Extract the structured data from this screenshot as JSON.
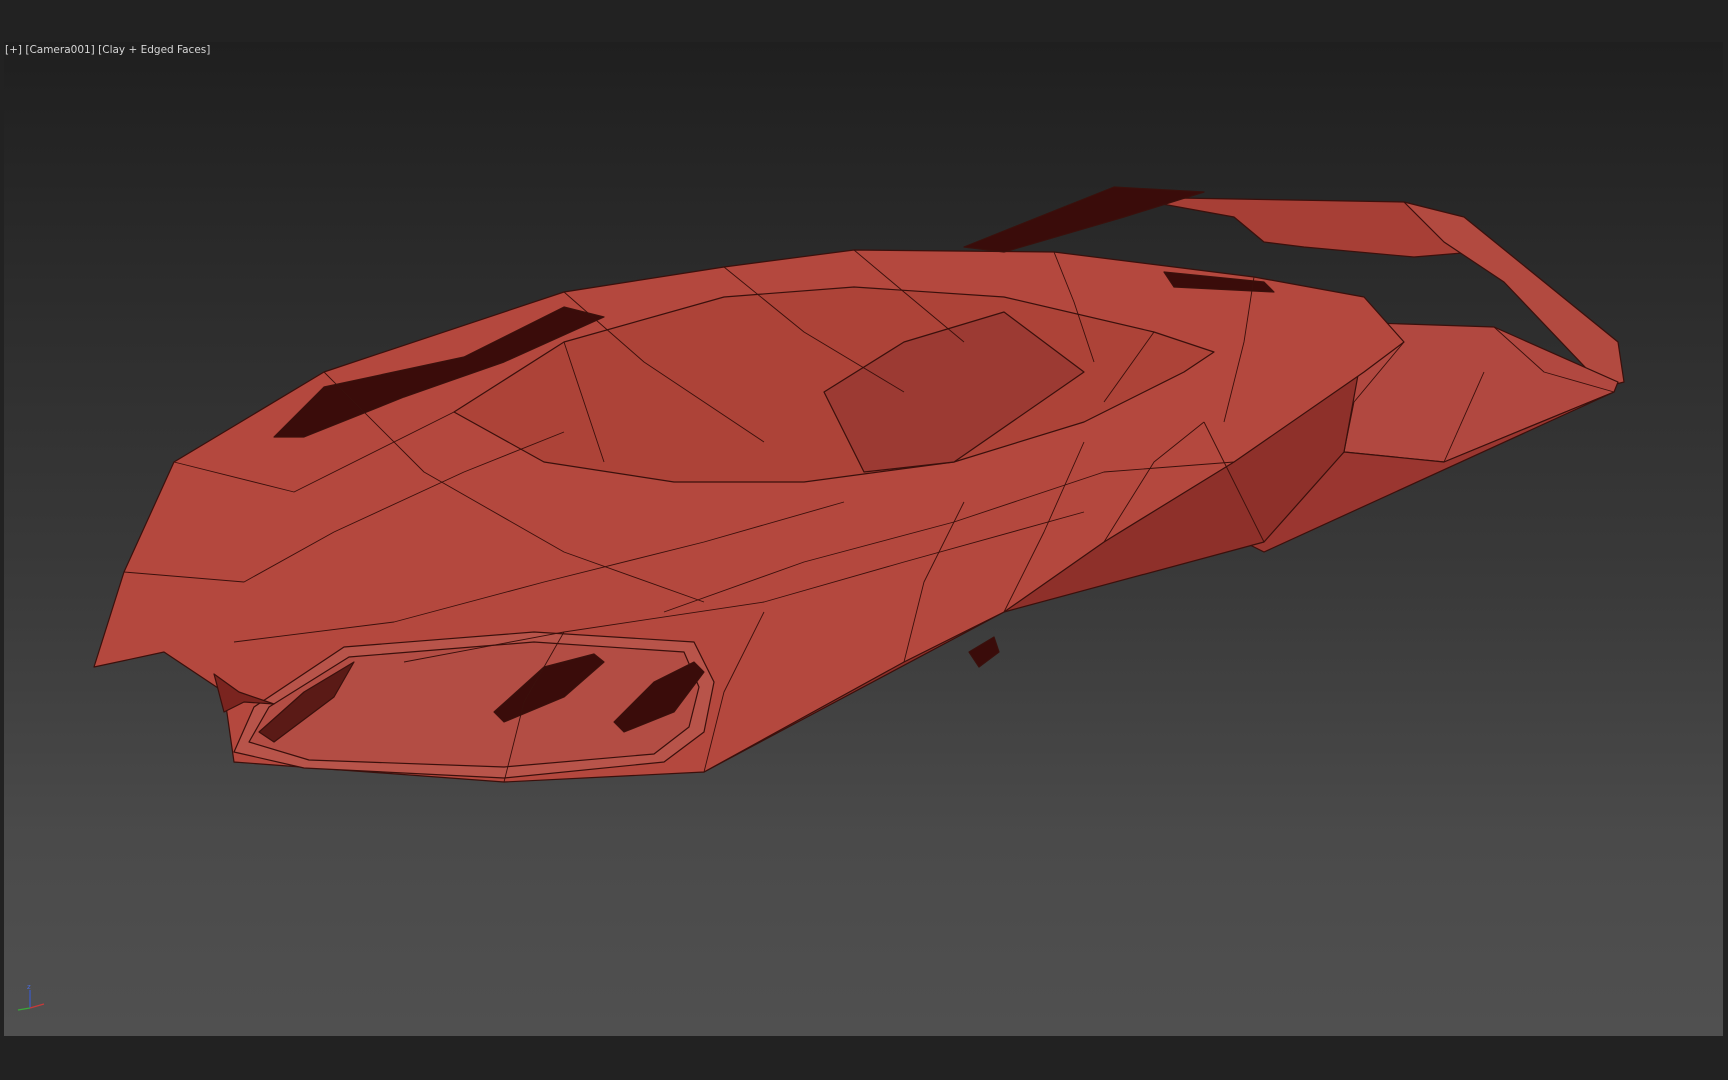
{
  "viewport": {
    "label_plus": "[+]",
    "label_camera": "[Camera001]",
    "label_shading": "[Clay + Edged Faces]",
    "background_top": "#1f1f1f",
    "background_bottom": "#505050"
  },
  "model": {
    "description_icon": "hover-vehicle-mesh",
    "clay_color": "#b0483e",
    "edge_color": "#3a100c",
    "shadow_color": "#8a2c26",
    "dark_cavity_color": "#3a0c0a"
  },
  "axis_gizmo": {
    "z_label": "z",
    "colors": {
      "x": "#c83a3a",
      "y": "#3aa83a",
      "z": "#3a5ac8"
    }
  }
}
